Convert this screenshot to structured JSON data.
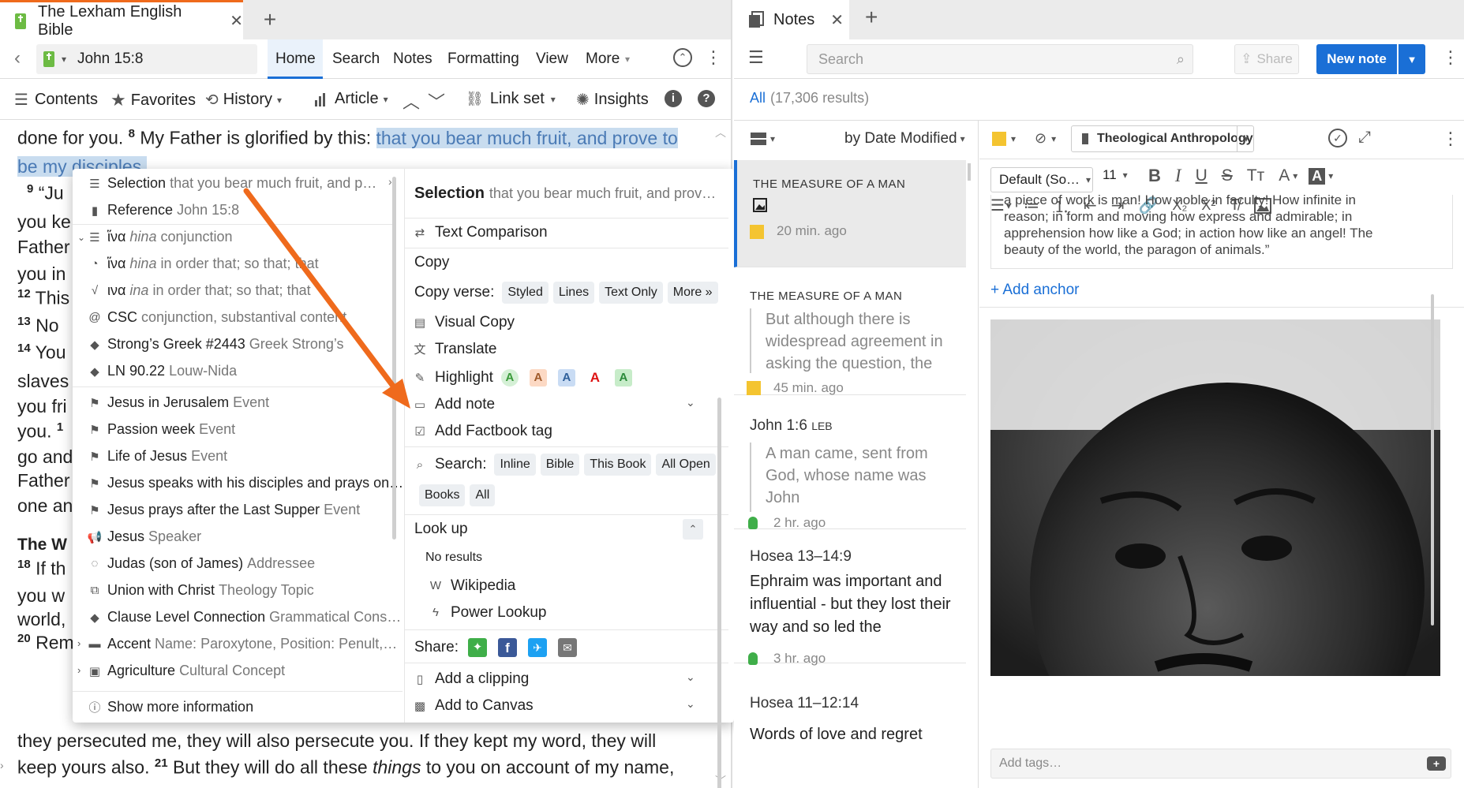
{
  "left_panel": {
    "tab": {
      "title": "The Lexham English Bible"
    },
    "reference": "John 15:8",
    "nav_tabs": [
      "Home",
      "Search",
      "Notes",
      "Formatting",
      "View",
      "More"
    ],
    "toolbar": {
      "contents": "Contents",
      "favorites": "Favorites",
      "history": "History",
      "article": "Article",
      "link_set": "Link set",
      "insights": "Insights"
    },
    "reader": {
      "line1_pre": "done for you.",
      "v8": "8",
      "line1_mid": "My Father is glorified by this:",
      "line1_hl": "that you bear much fruit, and prove to",
      "line2_hl": "be my disciples.",
      "v9": "9",
      "v9_frag": "“Ju",
      "frag3": "you ke",
      "frag4": "Father",
      "frag5": "you in",
      "v12": "12",
      "frag6": "This",
      "v13": "13",
      "frag7": "No",
      "v14": "14",
      "frag8": "You",
      "frag9": "slaves",
      "frag10": "you fri",
      "frag11": "you.",
      "v15": "1",
      "frag12": "go and",
      "frag13": "Father",
      "frag14": "one an",
      "heading_frag": "The W",
      "v18": "18",
      "frag15": "If th",
      "frag16": "you w",
      "frag17": "world,",
      "v20": "20",
      "frag18": "Rem",
      "bottom1": "they persecuted me, they will also persecute you. If they kept my word, they will",
      "bottom2_a": "keep yours also.",
      "v21": "21",
      "bottom2_b": "But they will do all these",
      "bottom2_i": "things",
      "bottom2_c": "to you on account of my name,"
    },
    "popup": {
      "left_items": [
        {
          "label": "Selection",
          "detail": "that you bear much fruit, and p…"
        },
        {
          "label": "Reference",
          "detail": "John 15:8"
        },
        {
          "label": "ἵνα",
          "italic": "hina",
          "detail": "conjunction"
        },
        {
          "label": "ἵνα",
          "italic": "hina",
          "detail": "in order that; so that; that"
        },
        {
          "label": "ινα",
          "italic": "ina",
          "detail": "in order that; so that; that"
        },
        {
          "label": "CSC",
          "detail": "conjunction, substantival content"
        },
        {
          "label": "Strong’s Greek #2443",
          "detail": "Greek Strong’s"
        },
        {
          "label": "LN 90.22",
          "detail": "Louw-Nida"
        },
        {
          "label": "Jesus in Jerusalem",
          "detail": "Event"
        },
        {
          "label": "Passion week",
          "detail": "Event"
        },
        {
          "label": "Life of Jesus",
          "detail": "Event"
        },
        {
          "label": "Jesus speaks with his disciples and prays on…",
          "detail": ""
        },
        {
          "label": "Jesus prays after the Last Supper",
          "detail": "Event"
        },
        {
          "label": "Jesus",
          "detail": "Speaker"
        },
        {
          "label": "Judas (son of James)",
          "detail": "Addressee"
        },
        {
          "label": "Union with Christ",
          "detail": "Theology Topic"
        },
        {
          "label": "Clause Level Connection",
          "detail": "Grammatical Cons…"
        },
        {
          "label": "Accent",
          "detail": "Name: Paroxytone, Position: Penult,…"
        },
        {
          "label": "Agriculture",
          "detail": "Cultural Concept"
        }
      ],
      "show_more": "Show more information",
      "right": {
        "header_label": "Selection",
        "header_detail": "that you bear much fruit, and prov…",
        "text_comparison": "Text Comparison",
        "copy": "Copy",
        "copy_verse": "Copy verse:",
        "copy_chips": [
          "Styled",
          "Lines",
          "Text Only",
          "More »"
        ],
        "visual_copy": "Visual Copy",
        "translate": "Translate",
        "highlight": "Highlight",
        "highlight_swatches": [
          "A",
          "A",
          "A",
          "A",
          "A"
        ],
        "add_note": "Add note",
        "add_factbook_tag": "Add Factbook tag",
        "search": "Search:",
        "search_chips": [
          "Inline",
          "Bible",
          "This Book",
          "All Open",
          "Books",
          "All"
        ],
        "look_up": "Look up",
        "no_results": "No results",
        "wikipedia": "Wikipedia",
        "power_lookup": "Power Lookup",
        "share": "Share:",
        "add_clipping": "Add a clipping",
        "add_to_canvas": "Add to Canvas"
      }
    }
  },
  "right_panel": {
    "tab": {
      "title": "Notes"
    },
    "search_placeholder": "Search",
    "share_label": "Share",
    "new_note_label": "New note",
    "filter": {
      "all": "All",
      "count": "(17,306 results)"
    },
    "sort_label": "by Date Modified",
    "notes": [
      {
        "title": "THE MEASURE OF A MAN",
        "time": "20 min. ago"
      },
      {
        "title": "THE MEASURE OF A MAN",
        "quote": "But although there is widespread agreement in asking the question, the",
        "time": "45 min. ago"
      },
      {
        "title": "John 1:6",
        "tag": "LEB",
        "quote": "A man came, sent from God, whose name was John",
        "time": "2 hr. ago"
      },
      {
        "title": "Hosea 13–14:9",
        "body": "Ephraim was important and influential - but they lost their way and so led the",
        "time": "3 hr. ago"
      },
      {
        "title": "Hosea 11–12:14",
        "body": "Words of love and regret"
      }
    ],
    "editor": {
      "notebook": "Theological Anthropology",
      "font": "Default (So…",
      "font_size": "11",
      "quote_text": [
        "a piece of work is man! How noble in faculty! How infinite in",
        "reason; in form and moving how express and admirable; in",
        "apprehension how like a God; in action how like an angel! The",
        "beauty of the world, the paragon of animals.”"
      ],
      "add_anchor": "+ Add anchor",
      "add_tags_placeholder": "Add tags…"
    }
  },
  "colors": {
    "accent_blue": "#1a6fd6",
    "highlight_bg": "#c8dcef",
    "arrow_orange": "#ef6a1c",
    "note_yellow": "#f4c430",
    "bulb_green": "#3fae49"
  }
}
